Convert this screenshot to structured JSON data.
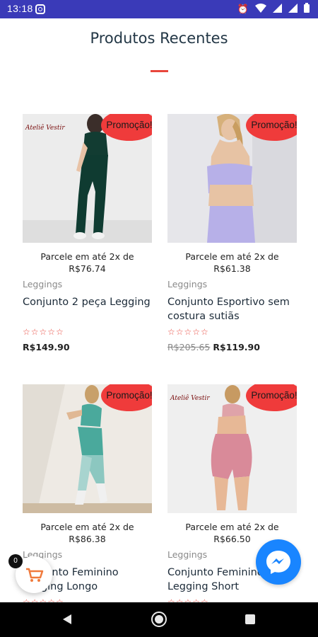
{
  "status_bar": {
    "time": "13:18",
    "icons": [
      "instagram-icon",
      "alarm-icon",
      "wifi-icon",
      "signal-icon",
      "signal-icon",
      "battery-icon"
    ]
  },
  "section": {
    "title": "Produtos Recentes",
    "accent_color": "#e8463c"
  },
  "products": [
    {
      "installment_line1": "Parcele em até 2x de",
      "installment_line2": "R$76.74",
      "badge": "Promoção!",
      "category": "Leggings",
      "name": "Conjunto 2 peça Legging",
      "rating_stars": "☆☆☆☆☆",
      "old_price": "",
      "price": "R$149.90",
      "logo_text": "Ateliê Vestir"
    },
    {
      "installment_line1": "Parcele em até 2x de",
      "installment_line2": "R$61.38",
      "badge": "Promoção!",
      "category": "Leggings",
      "name": "Conjunto Esportivo sem costura sutiãs",
      "rating_stars": "☆☆☆☆☆",
      "old_price": "R$205.65",
      "price": "R$119.90"
    },
    {
      "installment_line1": "Parcele em até 2x de",
      "installment_line2": "R$86.38",
      "badge": "Promoção!",
      "category": "Leggings",
      "name": "Conjunto Feminino Legging Longo",
      "rating_stars": "☆☆☆☆☆"
    },
    {
      "installment_line1": "Parcele em até 2x de",
      "installment_line2": "R$66.50",
      "badge": "Promoção!",
      "category": "Leggings",
      "name": "Conjunto Feminino Legging Short",
      "rating_stars": "☆☆☆☆☆",
      "logo_text": "Ateliê Vestir"
    }
  ],
  "cart": {
    "count": "0",
    "icon": "cart-icon",
    "color": "#f07a3c"
  },
  "messenger": {
    "icon": "messenger-icon",
    "color": "#1985ff"
  },
  "nav": {
    "icons": [
      "back-icon",
      "home-icon",
      "recents-icon"
    ]
  },
  "colors": {
    "status_bar": "#3a3ab8",
    "badge": "#ef3b3b",
    "stars": "#e8463c"
  }
}
